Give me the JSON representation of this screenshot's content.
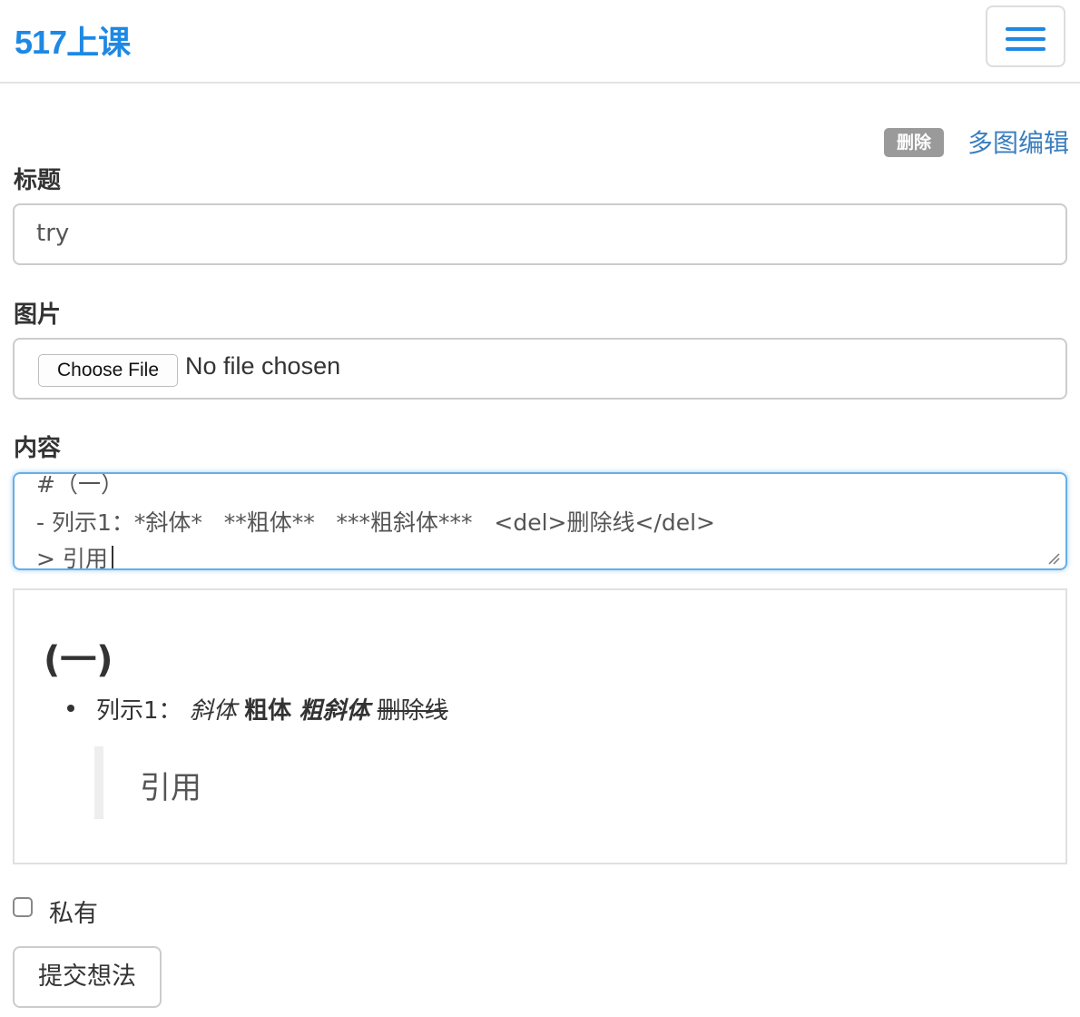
{
  "navbar": {
    "brand": "517上课",
    "menu_icon": "hamburger-menu-icon",
    "accent_color": "#1e88e5"
  },
  "actions": {
    "delete_badge": "删除",
    "multi_edit_link": "多图编辑"
  },
  "form": {
    "title": {
      "label": "标题",
      "value": "try"
    },
    "image": {
      "label": "图片",
      "button": "Choose File",
      "status": "No file chosen"
    },
    "content": {
      "label": "内容",
      "lines": [
        "#（一）",
        "- 列示1：*斜体*   **粗体**   ***粗斜体***   <del>删除线</del>",
        "> 引用"
      ]
    },
    "private": {
      "label": "私有",
      "checked": false
    },
    "submit": "提交想法"
  },
  "preview": {
    "heading": "(一)",
    "list_item": {
      "prefix": "列示1：",
      "italic": "斜体",
      "bold": "粗体",
      "bold_italic": "粗斜体",
      "strikethrough": "删除线"
    },
    "quote": "引用"
  }
}
